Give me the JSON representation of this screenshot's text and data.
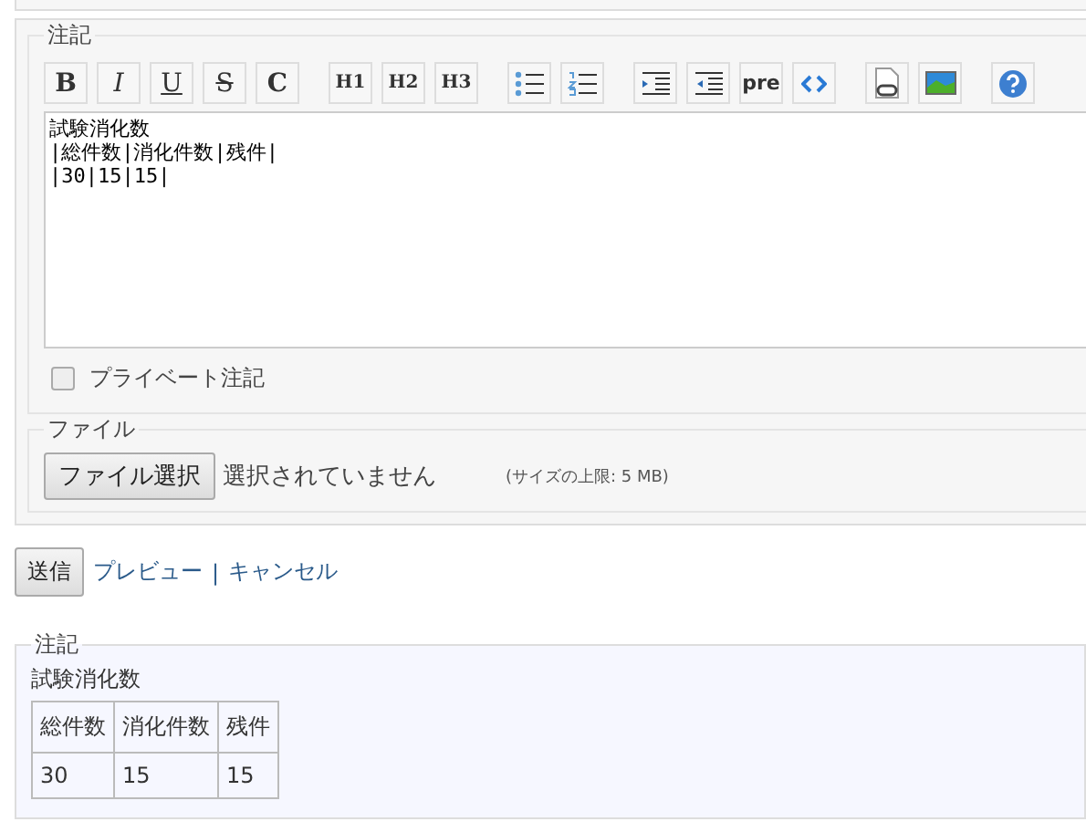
{
  "notes_form": {
    "legend": "注記",
    "toolbar": [
      [
        {
          "kind": "bold",
          "label": "B"
        },
        {
          "kind": "italic",
          "label": "I"
        },
        {
          "kind": "underline",
          "label": "U"
        },
        {
          "kind": "strike",
          "label": "S"
        },
        {
          "kind": "bold",
          "label": "C"
        }
      ],
      [
        {
          "kind": "heading",
          "label": "H1"
        },
        {
          "kind": "heading",
          "label": "H2"
        },
        {
          "kind": "heading",
          "label": "H3"
        }
      ],
      [
        {
          "kind": "bullets"
        },
        {
          "kind": "numbers"
        }
      ],
      [
        {
          "kind": "indent"
        },
        {
          "kind": "outdent"
        },
        {
          "kind": "plain",
          "label": "pre"
        },
        {
          "kind": "code"
        }
      ],
      [
        {
          "kind": "file"
        },
        {
          "kind": "image"
        }
      ],
      [
        {
          "kind": "help"
        }
      ]
    ],
    "text": "試験消化数\n|総件数|消化件数|残件|\n|30|15|15|",
    "private": {
      "label": "プライベート注記",
      "checked": false
    }
  },
  "file_section": {
    "legend": "ファイル",
    "button": "ファイル選択",
    "status": "選択されていません",
    "limit": "(サイズの上限: 5 MB)"
  },
  "actions": {
    "submit": "送信",
    "preview": "プレビュー",
    "separator": "|",
    "cancel": "キャンセル"
  },
  "preview": {
    "legend": "注記",
    "heading": "試験消化数",
    "columns": [
      "総件数",
      "消化件数",
      "残件"
    ],
    "rows": [
      [
        "30",
        "15",
        "15"
      ]
    ]
  }
}
